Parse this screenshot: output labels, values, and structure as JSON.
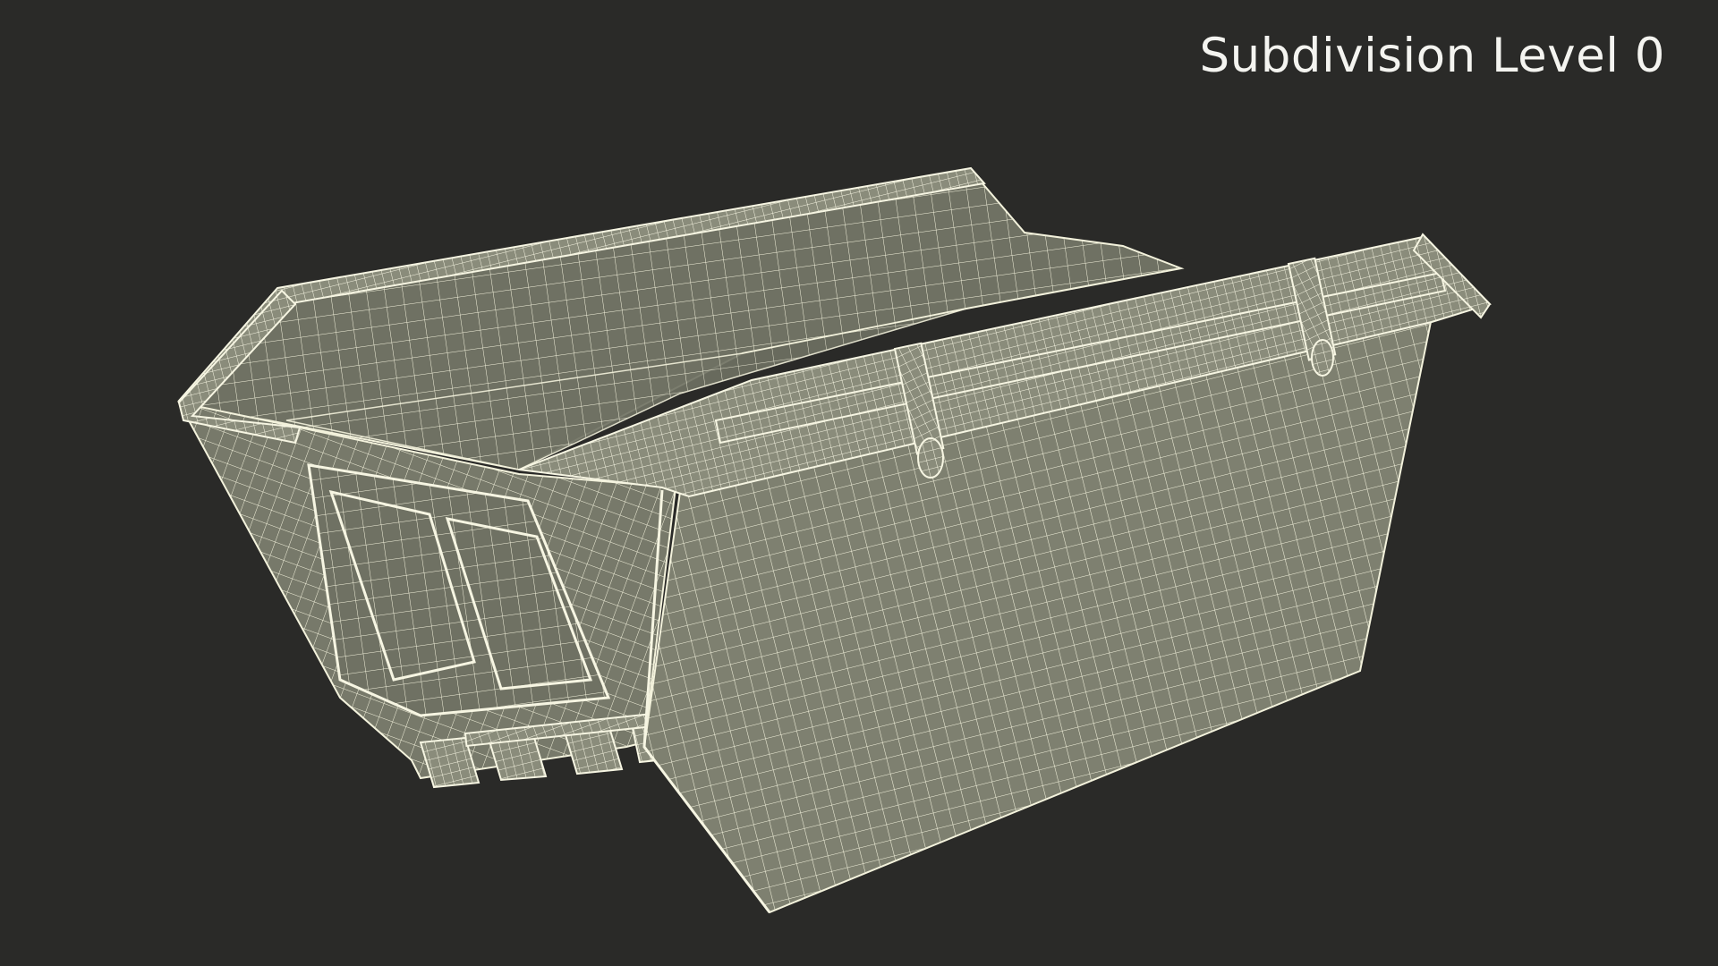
{
  "viewport": {
    "label": "Subdivision Level 0",
    "background_color": "#2a2a28",
    "subject": "skip-container-wireframe",
    "surface_color": "#7e8070",
    "surface_inner_color": "#6f7163",
    "wire_color": "#f3f2dc"
  }
}
